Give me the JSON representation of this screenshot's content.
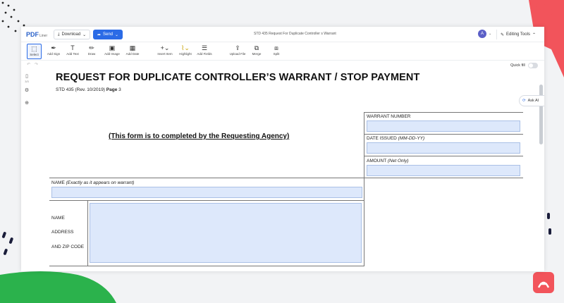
{
  "app": {
    "logo_text": "PDF",
    "logo_sub": "Liner",
    "download_label": "Download",
    "send_label": "Send",
    "document_title": "STD 435 Request For Duplicate Controller s Warrant",
    "avatar_initial": "A",
    "editing_tools_label": "Editing Tools"
  },
  "toolbar": {
    "items": [
      {
        "label": "Select",
        "icon": "cursor-icon"
      },
      {
        "label": "Add Sign",
        "icon": "pen-icon"
      },
      {
        "label": "Add Text",
        "icon": "text-icon"
      },
      {
        "label": "Draw",
        "icon": "draw-icon"
      },
      {
        "label": "Add Image",
        "icon": "image-icon"
      },
      {
        "label": "Add Date",
        "icon": "calendar-icon"
      },
      {
        "label": "Insert Item",
        "icon": "plus-icon"
      },
      {
        "label": "Highlight",
        "icon": "highlight-icon"
      },
      {
        "label": "Add Fields",
        "icon": "fields-icon"
      },
      {
        "label": "Upload File",
        "icon": "upload-icon"
      },
      {
        "label": "Merge",
        "icon": "merge-icon"
      },
      {
        "label": "Split",
        "icon": "split-icon"
      }
    ]
  },
  "subbar": {
    "quick_fill_label": "Quick fill"
  },
  "sidebar": {
    "page_count": "3/3"
  },
  "ask_ai_label": "Ask AI",
  "form": {
    "title": "REQUEST FOR DUPLICATE CONTROLLER’S WARRANT / STOP PAYMENT",
    "form_number": "STD 435 (Rev. 10/2019)",
    "page_label": "Page",
    "page_number": "3",
    "agency_note": "(This form is to completed by the Requesting Agency)",
    "warrant_number_label": "WARRANT NUMBER",
    "date_issued_label": "DATE ISSUED",
    "date_issued_hint": "(MM-DD-YY)",
    "amount_label": "AMOUNT",
    "amount_hint": "(Net Only)",
    "name_label": "NAME",
    "name_hint": "(Exactly as it appears on warrant)",
    "address_block_name": "NAME",
    "address_block_address": "ADDRESS",
    "address_block_zip": "AND ZIP CODE"
  },
  "colors": {
    "accent": "#2b6be6",
    "field_fill": "#dde8fb",
    "decor_red": "#f2545b",
    "decor_green": "#2bb24c"
  }
}
